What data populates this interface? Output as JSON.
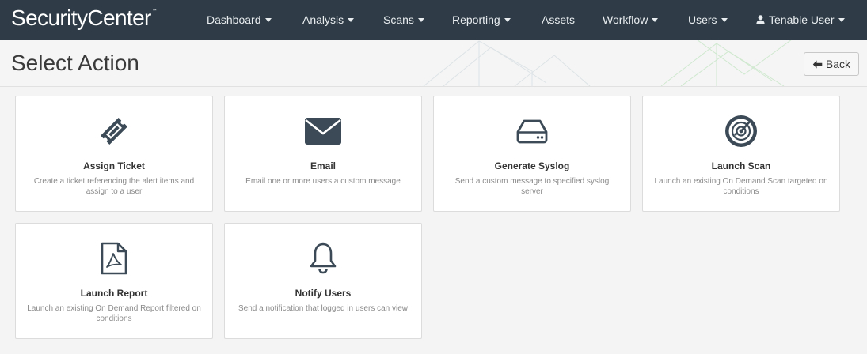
{
  "app": {
    "brand": "SecurityCenter",
    "brand_mark": "™"
  },
  "nav": {
    "items": [
      {
        "label": "Dashboard",
        "dropdown": true
      },
      {
        "label": "Analysis",
        "dropdown": true
      },
      {
        "label": "Scans",
        "dropdown": true
      },
      {
        "label": "Reporting",
        "dropdown": true
      },
      {
        "label": "Assets",
        "dropdown": false
      },
      {
        "label": "Workflow",
        "dropdown": true
      },
      {
        "label": "Users",
        "dropdown": true
      }
    ],
    "user": {
      "label": "Tenable User",
      "icon": "user-icon",
      "dropdown": true
    }
  },
  "page": {
    "title": "Select Action",
    "back_label": "Back"
  },
  "actions": [
    {
      "icon": "ticket-icon",
      "title": "Assign Ticket",
      "description": "Create a ticket referencing the alert items and assign to a user"
    },
    {
      "icon": "envelope-icon",
      "title": "Email",
      "description": "Email one or more users a custom message"
    },
    {
      "icon": "hard-drive-icon",
      "title": "Generate Syslog",
      "description": "Send a custom message to specified syslog server"
    },
    {
      "icon": "radar-icon",
      "title": "Launch Scan",
      "description": "Launch an existing On Demand Scan targeted on conditions"
    },
    {
      "icon": "pdf-file-icon",
      "title": "Launch Report",
      "description": "Launch an existing On Demand Report filtered on conditions"
    },
    {
      "icon": "bell-icon",
      "title": "Notify Users",
      "description": "Send a notification that logged in users can view"
    }
  ],
  "colors": {
    "navbar": "#2f3c47",
    "icon": "#3b4a56",
    "page_bg": "#f4f4f4",
    "card_bg": "#ffffff",
    "card_border": "#dcdcdc",
    "description_text": "#8a8a8a"
  }
}
